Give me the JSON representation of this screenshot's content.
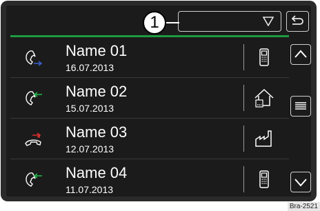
{
  "header": {
    "callout_number": "1",
    "filter_dropdown_icon": "triangle-down-icon",
    "back_icon": "back-arrow-icon"
  },
  "colors": {
    "accent_line": "#1e9a42",
    "outgoing_arrow": "#3a5fcd",
    "incoming_arrow": "#21b24b",
    "missed_arrow": "#e03030"
  },
  "call_list": [
    {
      "name": "Name 01",
      "date": "16.07.2013",
      "call_icon": "outgoing-call-icon",
      "type_icon": "mobile-phone-icon"
    },
    {
      "name": "Name 02",
      "date": "15.07.2013",
      "call_icon": "incoming-call-icon",
      "type_icon": "home-icon"
    },
    {
      "name": "Name 03",
      "date": "12.07.2013",
      "call_icon": "missed-call-icon",
      "type_icon": "work-icon"
    },
    {
      "name": "Name 04",
      "date": "11.07.2013",
      "call_icon": "incoming-call-icon",
      "type_icon": "mobile-phone-icon"
    }
  ],
  "scrollbar": {
    "up_icon": "chevron-up-icon",
    "middle_icon": "list-lines-icon",
    "down_icon": "chevron-down-icon"
  },
  "figure_ref": "Bra-2521"
}
